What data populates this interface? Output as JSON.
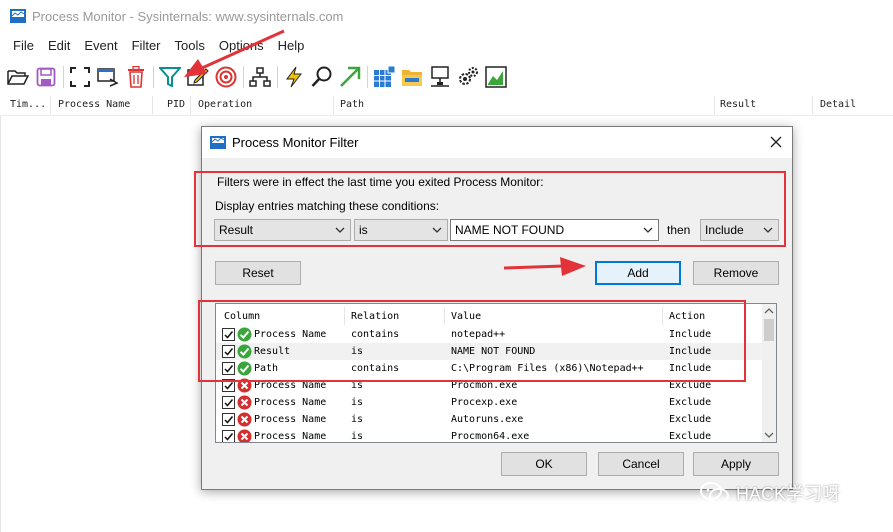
{
  "window": {
    "title": "Process Monitor - Sysinternals: www.sysinternals.com"
  },
  "menu": [
    "File",
    "Edit",
    "Event",
    "Filter",
    "Tools",
    "Options",
    "Help"
  ],
  "toolbar_icons": [
    "open-icon",
    "save-icon",
    "autoscroll-icon",
    "capture-icon",
    "clear-icon",
    "filter-icon",
    "highlight-icon",
    "target-icon",
    "process-tree-icon",
    "events-icon",
    "find-icon",
    "jump-icon",
    "registry-icon",
    "file-system-icon",
    "network-icon",
    "process-activity-icon",
    "profiling-icon"
  ],
  "columns": [
    "Tim...",
    "Process Name",
    "PID",
    "Operation",
    "Path",
    "Result",
    "Detail"
  ],
  "dialog": {
    "title": "Process Monitor Filter",
    "line1": "Filters were in effect the last time you exited Process Monitor:",
    "line2": "Display entries matching these conditions:",
    "column_select": "Result",
    "relation_select": "is",
    "value_input": "NAME NOT FOUND",
    "then_label": "then",
    "action_select": "Include",
    "reset": "Reset",
    "add": "Add",
    "remove": "Remove",
    "ok": "OK",
    "cancel": "Cancel",
    "apply": "Apply",
    "list_headers": [
      "Column",
      "Relation",
      "Value",
      "Action"
    ],
    "rows": [
      {
        "column": "Process Name",
        "relation": "contains",
        "value": "notepad++",
        "action": "Include",
        "status": "include"
      },
      {
        "column": "Result",
        "relation": "is",
        "value": "NAME NOT FOUND",
        "action": "Include",
        "status": "include"
      },
      {
        "column": "Path",
        "relation": "contains",
        "value": "C:\\Program Files (x86)\\Notepad++",
        "action": "Include",
        "status": "include"
      },
      {
        "column": "Process Name",
        "relation": "is",
        "value": "Procmon.exe",
        "action": "Exclude",
        "status": "exclude"
      },
      {
        "column": "Process Name",
        "relation": "is",
        "value": "Procexp.exe",
        "action": "Exclude",
        "status": "exclude"
      },
      {
        "column": "Process Name",
        "relation": "is",
        "value": "Autoruns.exe",
        "action": "Exclude",
        "status": "exclude"
      },
      {
        "column": "Process Name",
        "relation": "is",
        "value": "Procmon64.exe",
        "action": "Exclude",
        "status": "exclude"
      }
    ]
  },
  "watermark": "HACK学习呀",
  "colors": {
    "annotation_red": "#e2333a",
    "include_green": "#3aa53a",
    "exclude_red": "#d32f2f",
    "focus_blue": "#0078d7"
  }
}
